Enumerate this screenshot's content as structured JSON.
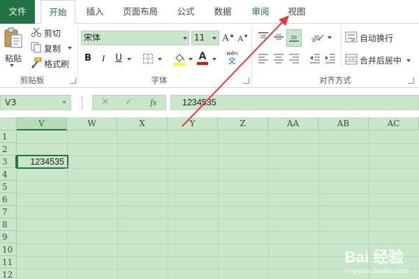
{
  "tabs": [
    "文件",
    "开始",
    "插入",
    "页面布局",
    "公式",
    "数据",
    "审阅",
    "视图"
  ],
  "clipboard": {
    "paste_label": "粘贴",
    "cut_label": "剪切",
    "copy_label": "复制",
    "format_painter_label": "格式刷",
    "group_label": "剪贴板"
  },
  "font": {
    "font_name": "宋体",
    "font_size": "11",
    "bold": "B",
    "italic": "I",
    "underline": "U",
    "font_color_glyph": "A",
    "phonetic_glyph": "wén",
    "group_label": "字体"
  },
  "alignment": {
    "wrap_text_label": "自动换行",
    "merge_center_label": "合并后居中",
    "group_label": "对齐方式"
  },
  "formula_bar": {
    "name_box": "V3",
    "fx_label": "fx",
    "formula_value": "1234535"
  },
  "sheet": {
    "columns": [
      "V",
      "W",
      "X",
      "Y",
      "Z",
      "AA",
      "AB",
      "AC"
    ],
    "rows": [
      "1",
      "2",
      "3",
      "4",
      "5",
      "6",
      "7",
      "8",
      "9",
      "10",
      "11",
      "12"
    ],
    "selected_cell": "V3",
    "cell_value": "1234535"
  },
  "colors": {
    "accent": "#217346",
    "grid_fill": "#c8e6c9",
    "arrow": "#e53935",
    "fill_yellow": "#ffff00",
    "font_red": "#ff0000"
  },
  "watermark": {
    "logo_text": "Bai 经验",
    "url_text": "jingyan.baidu.com"
  }
}
